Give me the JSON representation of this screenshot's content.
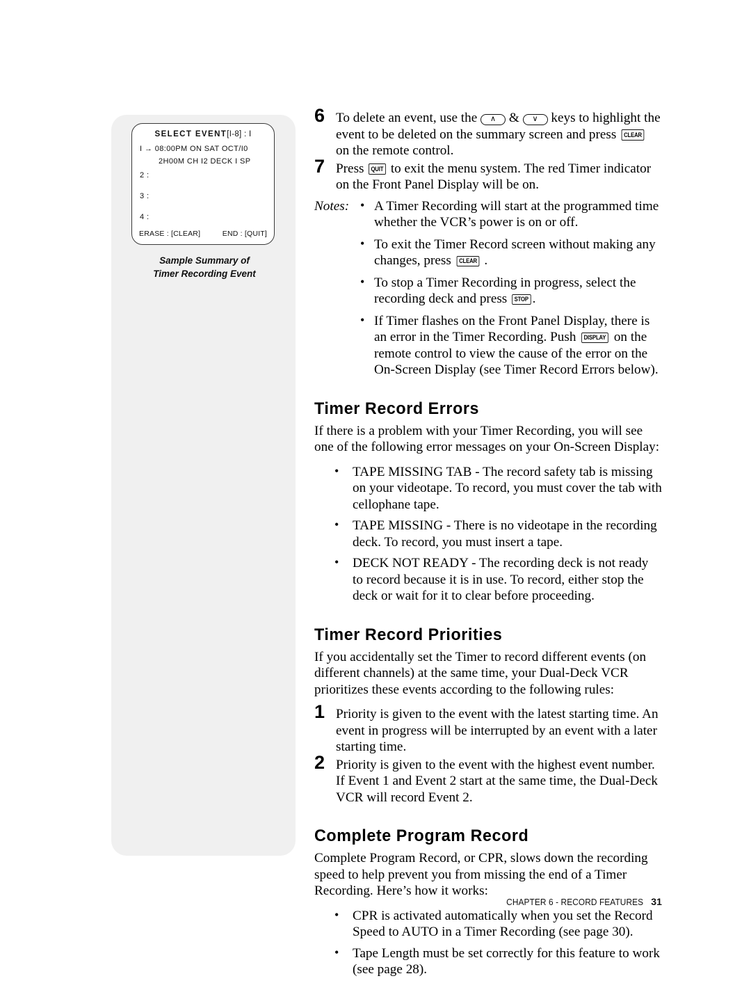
{
  "osd": {
    "title_main": "SELECT EVENT",
    "title_range": "[I-8] : I",
    "line1": "I →  08:00PM  ON  SAT  OCT/I0",
    "line2": "2H00M  CH  I2  DECK  I  SP",
    "line3": "2 :",
    "line4": "3 :",
    "line5": "4 :",
    "footer_left": "ERASE : [CLEAR]",
    "footer_right": "END : [QUIT]",
    "caption_line1": "Sample Summary of",
    "caption_line2": "Timer Recording Event"
  },
  "steps": [
    {
      "number": "6",
      "text_a": "To delete an event, use the ",
      "key_up": "∧",
      "text_b": " & ",
      "key_down": "∨",
      "text_c": " keys to highlight the event to be deleted on the summary screen and press ",
      "key_clear": "CLEAR",
      "text_d": " on the remote control."
    },
    {
      "number": "7",
      "text_a": "Press ",
      "key_quit": "QUIT",
      "text_b": " to exit the menu system. The red Timer indicator on the Front Panel Display will be on."
    }
  ],
  "notes": {
    "label": "Notes:",
    "bullet": "•",
    "items": [
      {
        "text_a": "A Timer Recording will start at the programmed time whether the VCR’s power is on or off.",
        "key": "",
        "text_b": ""
      },
      {
        "text_a": "To exit the Timer Record screen without making any changes, press ",
        "key": "CLEAR",
        "text_b": " ."
      },
      {
        "text_a": "To stop a Timer Recording in progress, select the recording deck and press ",
        "key": "STOP",
        "text_b": "."
      },
      {
        "text_a": "If Timer flashes on the Front Panel Display, there is an error in the Timer Recording. Push ",
        "key": "DISPLAY",
        "text_b": " on the remote control to view the cause of the error on the On-Screen Display (see Timer Record Errors below)."
      }
    ]
  },
  "timer_record_errors": {
    "heading": "Timer Record Errors",
    "intro": "If there is a problem with your Timer Recording, you will see one of the following error messages on your On-Screen Display:",
    "bullet": "•",
    "items": [
      "TAPE MISSING TAB - The record safety tab is missing on your videotape. To record, you must cover the tab with cellophane tape.",
      "TAPE MISSING - There is no videotape in the recording deck. To record, you must insert a tape.",
      "DECK NOT READY  - The recording deck is not ready to record because it is in use. To record, either stop the deck or wait for it to clear before proceeding."
    ]
  },
  "timer_record_priorities": {
    "heading": "Timer Record Priorities",
    "intro": "If you accidentally set the Timer to record different events (on different channels) at the same time, your Dual-Deck VCR prioritizes these events according to the following rules:",
    "rules": [
      {
        "number": "1",
        "text": "Priority is given to the event with the latest starting time. An event in progress will be interrupted by an event with a later starting time."
      },
      {
        "number": "2",
        "text": "Priority is given to the event with the highest event number. If Event 1 and Event 2 start at the same time, the Dual-Deck VCR will record Event 2."
      }
    ]
  },
  "complete_program_record": {
    "heading": "Complete Program Record",
    "intro": "Complete Program Record, or CPR, slows down the recording speed to help prevent you from missing the end of a Timer Recording. Here’s how it works:",
    "bullet": "•",
    "items": [
      "CPR is activated automatically when you set the Record Speed to AUTO in a Timer Recording (see page 30).",
      "Tape Length must be set correctly for this feature to work (see page 28)."
    ]
  },
  "footer": {
    "chapter": "CHAPTER 6 - RECORD FEATURES",
    "page": "31"
  },
  "colors": {
    "sidebar_panel": "#f0f0f0",
    "text": "#000000",
    "osd_border": "#3a3a3a"
  }
}
